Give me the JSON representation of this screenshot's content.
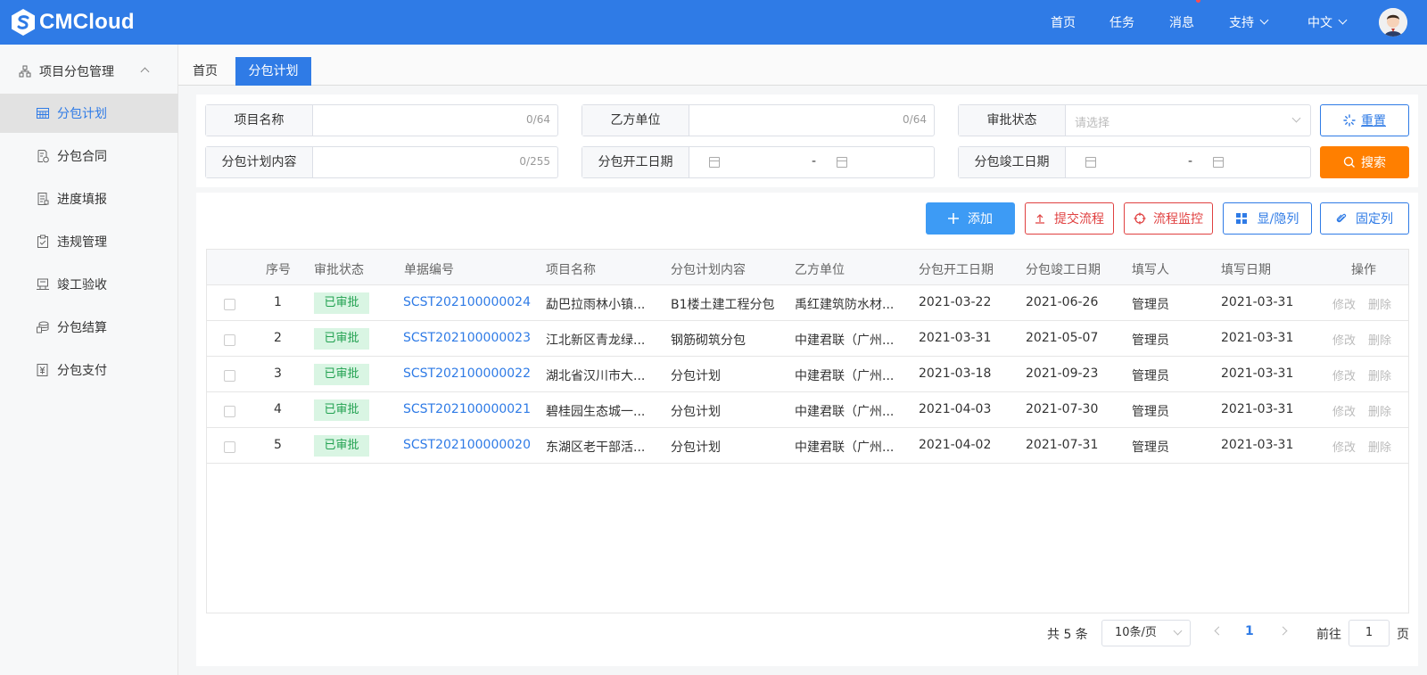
{
  "brand": {
    "name": "CMCloud"
  },
  "topnav": {
    "home": "首页",
    "tasks": "任务",
    "messages": "消息",
    "support": "支持",
    "language": "中文"
  },
  "sidebar": {
    "group": "项目分包管理",
    "items": [
      {
        "label": "分包计划",
        "icon": "calendar-grid-icon"
      },
      {
        "label": "分包合同",
        "icon": "contract-icon"
      },
      {
        "label": "进度填报",
        "icon": "report-icon"
      },
      {
        "label": "违规管理",
        "icon": "clipboard-check-icon"
      },
      {
        "label": "竣工验收",
        "icon": "inspection-icon"
      },
      {
        "label": "分包结算",
        "icon": "coins-icon"
      },
      {
        "label": "分包支付",
        "icon": "payment-icon"
      }
    ]
  },
  "tabs": {
    "home": "首页",
    "active": "分包计划"
  },
  "filters": {
    "project_name": {
      "label": "项目名称",
      "count": "0/64"
    },
    "party_b": {
      "label": "乙方单位",
      "count": "0/64"
    },
    "approval_status": {
      "label": "审批状态",
      "placeholder": "请选择"
    },
    "plan_content": {
      "label": "分包计划内容",
      "count": "0/255"
    },
    "start_date": {
      "label": "分包开工日期",
      "separator": "-"
    },
    "end_date": {
      "label": "分包竣工日期",
      "separator": "-"
    }
  },
  "buttons": {
    "reset": "重置",
    "search": "搜索",
    "add": "添加",
    "submit_flow": "提交流程",
    "monitor_flow": "流程监控",
    "toggle_columns": "显/隐列",
    "fix_columns": "固定列"
  },
  "table": {
    "headers": [
      "序号",
      "审批状态",
      "单据编号",
      "项目名称",
      "分包计划内容",
      "乙方单位",
      "分包开工日期",
      "分包竣工日期",
      "填写人",
      "填写日期",
      "操作"
    ],
    "rows": [
      {
        "index": "1",
        "status": "已审批",
        "code": "SCST202100000024",
        "project": "勐巴拉雨林小镇...",
        "content": "B1楼土建工程分包",
        "party": "禹红建筑防水材...",
        "start": "2021-03-22",
        "end": "2021-06-26",
        "filler": "管理员",
        "date": "2021-03-31",
        "edit": "修改",
        "delete": "删除"
      },
      {
        "index": "2",
        "status": "已审批",
        "code": "SCST202100000023",
        "project": "江北新区青龙绿...",
        "content": "钢筋砌筑分包",
        "party": "中建君联（广州...",
        "start": "2021-03-31",
        "end": "2021-05-07",
        "filler": "管理员",
        "date": "2021-03-31",
        "edit": "修改",
        "delete": "删除"
      },
      {
        "index": "3",
        "status": "已审批",
        "code": "SCST202100000022",
        "project": "湖北省汉川市大...",
        "content": "分包计划",
        "party": "中建君联（广州...",
        "start": "2021-03-18",
        "end": "2021-09-23",
        "filler": "管理员",
        "date": "2021-03-31",
        "edit": "修改",
        "delete": "删除"
      },
      {
        "index": "4",
        "status": "已审批",
        "code": "SCST202100000021",
        "project": "碧桂园生态城一...",
        "content": "分包计划",
        "party": "中建君联（广州...",
        "start": "2021-04-03",
        "end": "2021-07-30",
        "filler": "管理员",
        "date": "2021-03-31",
        "edit": "修改",
        "delete": "删除"
      },
      {
        "index": "5",
        "status": "已审批",
        "code": "SCST202100000020",
        "project": "东湖区老干部活...",
        "content": "分包计划",
        "party": "中建君联（广州...",
        "start": "2021-04-02",
        "end": "2021-07-31",
        "filler": "管理员",
        "date": "2021-03-31",
        "edit": "修改",
        "delete": "删除"
      }
    ]
  },
  "pagination": {
    "total": "共 5 条",
    "page_size": "10条/页",
    "current": "1",
    "goto_label": "前往",
    "goto_value": "1",
    "page_unit": "页"
  },
  "colors": {
    "primary": "#2f7be6",
    "search": "#ff7f00",
    "danger": "#e04040",
    "approved_bg": "#d9f5e3",
    "approved_text": "#21a150"
  }
}
